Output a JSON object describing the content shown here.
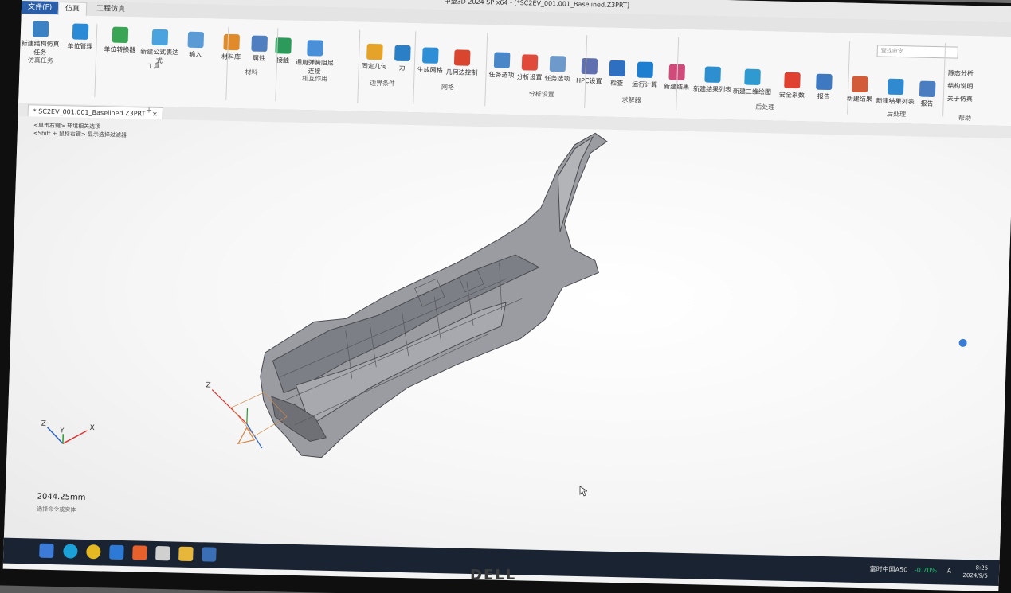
{
  "window": {
    "title": "中望3D 2024 SP x64 - [*SC2EV_001.001_Baselined.Z3PRT]"
  },
  "tabs": [
    {
      "label": "文件(F)"
    },
    {
      "label": "仿真"
    },
    {
      "label": "工程仿真"
    }
  ],
  "ribbon": {
    "tools": [
      {
        "label": "新建结构仿真任务",
        "icon": "new-task-icon"
      },
      {
        "label": "单位管理",
        "icon": "unit-icon"
      },
      {
        "label": "单位转换器",
        "icon": "calculator-icon"
      },
      {
        "label": "新建公式表达式",
        "icon": "formula-icon"
      },
      {
        "label": "输入",
        "icon": "input-icon"
      },
      {
        "label": "材料库",
        "icon": "material-icon"
      },
      {
        "label": "属性",
        "icon": "property-icon"
      },
      {
        "label": "接触",
        "icon": "contact-icon"
      },
      {
        "label": "通用弹簧阻尼连接",
        "icon": "spring-icon"
      },
      {
        "label": "固定几何",
        "icon": "fixed-icon"
      },
      {
        "label": "力",
        "icon": "force-icon"
      },
      {
        "label": "生成网格",
        "icon": "mesh-icon"
      },
      {
        "label": "几何边控制",
        "icon": "edge-control-icon"
      },
      {
        "label": "任务选项",
        "icon": "task-options-icon"
      },
      {
        "label": "分析设置",
        "icon": "analysis-settings-icon"
      },
      {
        "label": "任务选项",
        "icon": "task-options2-icon"
      },
      {
        "label": "HPC设置",
        "icon": "hpc-icon"
      },
      {
        "label": "检查",
        "icon": "check-icon"
      },
      {
        "label": "运行计算",
        "icon": "run-icon"
      },
      {
        "label": "新建结果",
        "icon": "result-icon"
      },
      {
        "label": "新建结果列表",
        "icon": "result-list-icon"
      },
      {
        "label": "新建二维绘图",
        "icon": "plot-2d-icon"
      },
      {
        "label": "安全系数",
        "icon": "safety-icon"
      },
      {
        "label": "报告",
        "icon": "report-icon"
      },
      {
        "label": "新建结果",
        "icon": "result2-icon"
      },
      {
        "label": "新建结果列表",
        "icon": "result-list2-icon"
      },
      {
        "label": "报告",
        "icon": "report2-icon"
      }
    ],
    "groups": [
      "仿真任务",
      "工具",
      "材料",
      "相互作用",
      "边界条件",
      "网格",
      "分析设置",
      "求解器",
      "后处理",
      "后处理",
      "帮助"
    ],
    "help": {
      "static": "静态分析",
      "structure": "结构说明",
      "about": "关于仿真"
    },
    "search_placeholder": "查找命令"
  },
  "document": {
    "tab_label": "* SC2EV_001.001_Baselined.Z3PRT",
    "close": "×",
    "add": "+"
  },
  "viewport": {
    "hint1": "<单击右键> 环境相关选项",
    "hint2": "<Shift + 鼠标右键> 显示选择过滤器",
    "scale": "2044.25mm",
    "status": "选择命令或实体",
    "triad": {
      "x": "X",
      "y": "Y",
      "z": "Z"
    }
  },
  "taskbar": {
    "stock": "富时中国A50",
    "change": "-0.70%",
    "time": "8:25",
    "date": "2024/9/5",
    "ime": "A"
  },
  "monitor": {
    "brand": "DELL"
  },
  "colors": {
    "accent": "#2b5ea8",
    "ribbon": "#f7f7f7",
    "taskbar": "#1a2331",
    "model": "#8e9096"
  }
}
